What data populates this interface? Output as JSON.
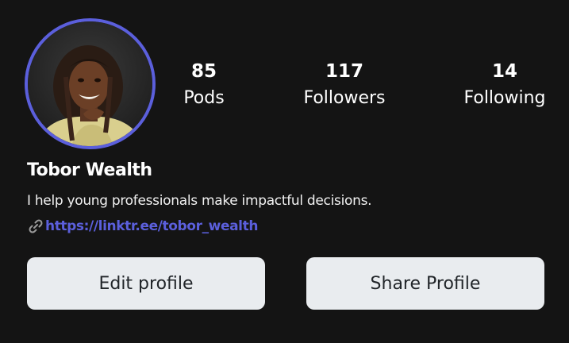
{
  "profile": {
    "avatar_alt": "Profile photo",
    "name": "Tobor Wealth",
    "bio": "I help young professionals make impactful decisions.",
    "link_icon": "link-icon",
    "link_url": "https://linktr.ee/tobor_wealth"
  },
  "stats": [
    {
      "value": "85",
      "label": "Pods"
    },
    {
      "value": "117",
      "label": "Followers"
    },
    {
      "value": "14",
      "label": "Following"
    }
  ],
  "actions": {
    "edit_label": "Edit profile",
    "share_label": "Share Profile"
  },
  "colors": {
    "background": "#141414",
    "accent": "#5b5fdc",
    "button_bg": "#e9ecef",
    "button_text": "#212529"
  }
}
